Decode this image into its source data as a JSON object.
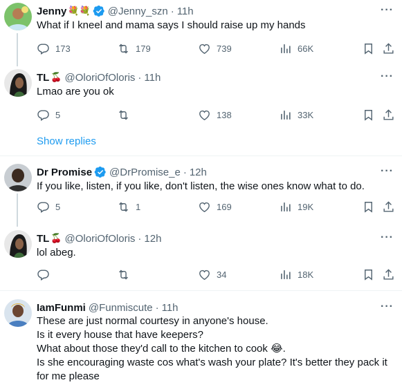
{
  "tweets": [
    {
      "name": "Jenny",
      "emoji": "💐💐",
      "handle": "@Jenny_szn",
      "dot": "·",
      "time": "11h",
      "text": "What if I kneel and mama says I should raise up my hands",
      "replies": "173",
      "reposts": "179",
      "likes": "739",
      "views": "66K"
    },
    {
      "name": "TL",
      "emoji": "🍒",
      "handle": "@OloriOfOloris",
      "dot": "·",
      "time": "11h",
      "text": "Lmao are you ok",
      "replies": "5",
      "reposts": "",
      "likes": "138",
      "views": "33K"
    },
    {
      "name": "Dr Promise",
      "handle": "@DrPromise_e",
      "dot": "·",
      "time": "12h",
      "text": "If you like, listen, if you like, don't listen, the wise ones know what to do.",
      "replies": "5",
      "reposts": "1",
      "likes": "169",
      "views": "19K"
    },
    {
      "name": "TL",
      "emoji": "🍒",
      "handle": "@OloriOfOloris",
      "dot": "·",
      "time": "12h",
      "text": "lol abeg.",
      "replies": "",
      "reposts": "",
      "likes": "34",
      "views": "18K"
    },
    {
      "name": "IamFunmi",
      "handle": "@Funmiscute",
      "dot": "·",
      "time": "11h",
      "text": "These are just normal courtesy in anyone's house.\nIs it every house that have keepers?\nWhat about those they'd call to the kitchen to cook 😂.\nIs she encouraging waste cos what's wash your plate? It's better they pack it for me please"
    }
  ],
  "show_replies": "Show replies",
  "more_glyph": "···",
  "colors": {
    "accent": "#1d9bf0",
    "muted": "#536471",
    "separator": "#eff3f4",
    "thread": "#cfd9de"
  },
  "icons": [
    "reply-icon",
    "repost-icon",
    "like-icon",
    "views-icon",
    "bookmark-icon",
    "share-icon",
    "verified-badge-icon",
    "more-icon"
  ]
}
